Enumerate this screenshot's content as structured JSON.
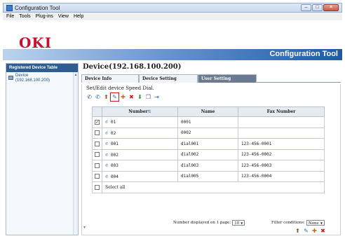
{
  "window": {
    "title": "Configuration Tool",
    "buttons": [
      "–",
      "□",
      "✕"
    ]
  },
  "menu": [
    "File",
    "Tools",
    "Plug-ins",
    "View",
    "Help"
  ],
  "header": {
    "logo": "OKI",
    "app_title": "Configuration Tool"
  },
  "sidebar": {
    "heading": "Registered Device Table",
    "device_label": "Device",
    "device_ip": "(192.168.100.200)"
  },
  "main": {
    "device_title": "Device(192.168.100.200)",
    "tabs": [
      "Device Info",
      "Device Setting",
      "User Setting"
    ],
    "section_title": "Set/Edit device Speed Dial.",
    "table": {
      "headers": [
        "Number",
        "Name",
        "Fax Number"
      ],
      "rows": [
        {
          "checked": "✓",
          "number": "01",
          "name": "0001",
          "fax": ""
        },
        {
          "checked": "",
          "number": "02",
          "name": "0002",
          "fax": ""
        },
        {
          "checked": "",
          "number": "001",
          "name": "dial001",
          "fax": "123-456-0001"
        },
        {
          "checked": "",
          "number": "002",
          "name": "dial002",
          "fax": "123-456-0002"
        },
        {
          "checked": "",
          "number": "003",
          "name": "dial003",
          "fax": "123-456-0003"
        },
        {
          "checked": "",
          "number": "004",
          "name": "dial005",
          "fax": "123-456-0004"
        }
      ],
      "select_all": "Select all"
    },
    "pager": {
      "label": "Number displayed on 1 page:",
      "value": "10"
    },
    "filter": {
      "label": "Filter conditions:",
      "value": "None"
    }
  },
  "colors": {
    "accent": "#1f5aa6",
    "logo_red": "#c8102e",
    "sidebar_head": "#2f5d92",
    "highlight": "#d31a1a"
  },
  "icons": {
    "toolbar": [
      "speed-dial-icon",
      "group-dial-icon",
      "import-icon",
      "edit-icon",
      "new-icon",
      "delete-icon",
      "export-icon",
      "copy-icon",
      "send-icon"
    ],
    "bottom": [
      "import-icon",
      "edit-icon",
      "new-icon",
      "delete-icon"
    ]
  }
}
